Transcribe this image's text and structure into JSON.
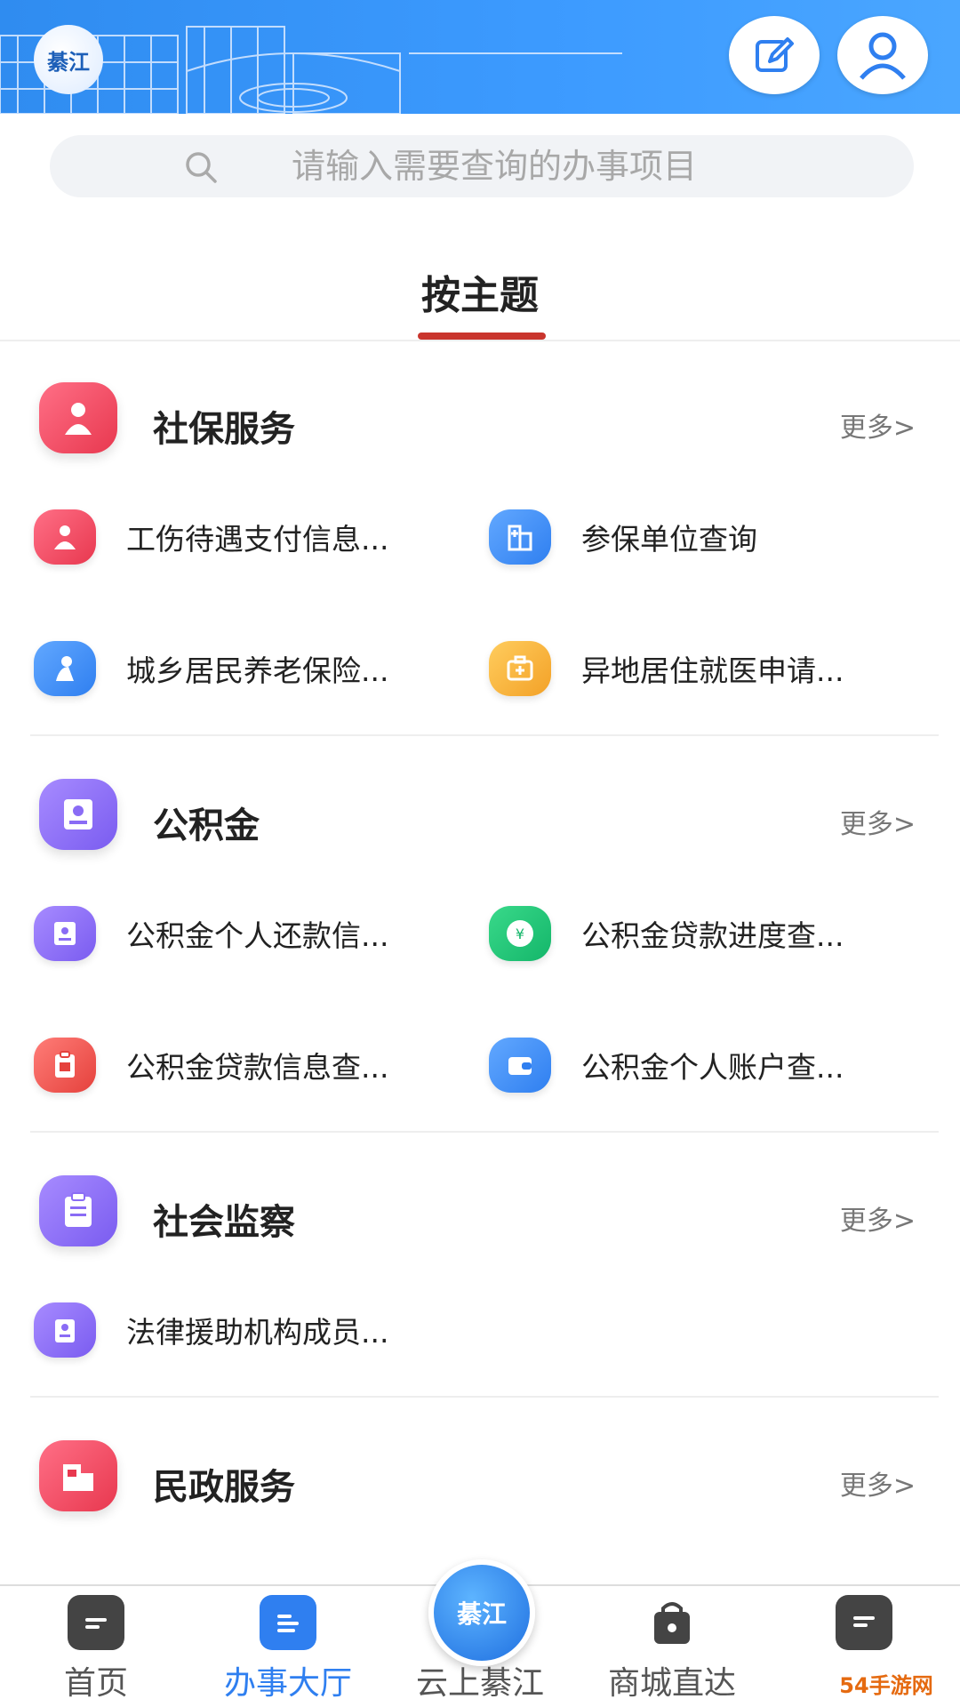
{
  "header": {
    "logo_text": "綦江",
    "edit_icon": "edit-icon",
    "user_icon": "user-icon"
  },
  "search": {
    "placeholder": "请输入需要查询的办事项目"
  },
  "tabs": [
    {
      "label": "按主题",
      "active": true
    }
  ],
  "sections": [
    {
      "title": "社保服务",
      "more": "更多>",
      "items": [
        {
          "label": "工伤待遇支付信息...",
          "icon": "injury-person-icon"
        },
        {
          "label": "参保单位查询",
          "icon": "hospital-building-icon"
        },
        {
          "label": "城乡居民养老保险...",
          "icon": "elder-person-icon"
        },
        {
          "label": "异地居住就医申请...",
          "icon": "medical-kit-icon"
        }
      ]
    },
    {
      "title": "公积金",
      "more": "更多>",
      "items": [
        {
          "label": "公积金个人还款信...",
          "icon": "id-card-icon"
        },
        {
          "label": "公积金贷款进度查...",
          "icon": "loan-icon"
        },
        {
          "label": "公积金贷款信息查...",
          "icon": "loan-clipboard-icon"
        },
        {
          "label": "公积金个人账户查...",
          "icon": "wallet-icon"
        }
      ]
    },
    {
      "title": "社会监察",
      "more": "更多>",
      "items": [
        {
          "label": "法律援助机构成员...",
          "icon": "clipboard-person-icon"
        }
      ]
    },
    {
      "title": "民政服务",
      "more": "更多>",
      "items": []
    }
  ],
  "bottom_nav": [
    {
      "label": "首页",
      "icon": "home-chat-icon",
      "active": false
    },
    {
      "label": "办事大厅",
      "icon": "service-hall-icon",
      "active": true
    },
    {
      "label": "云上綦江",
      "icon": "cloud-qijiang-logo-icon",
      "active": false
    },
    {
      "label": "商城直达",
      "icon": "shopping-bag-icon",
      "active": false
    },
    {
      "label": "",
      "icon": "message-icon",
      "active": false
    }
  ],
  "watermark": "54手游网",
  "colors": {
    "header_blue": "#3d9bff",
    "accent_red": "#c9352d",
    "nav_active": "#2f7ff0"
  }
}
